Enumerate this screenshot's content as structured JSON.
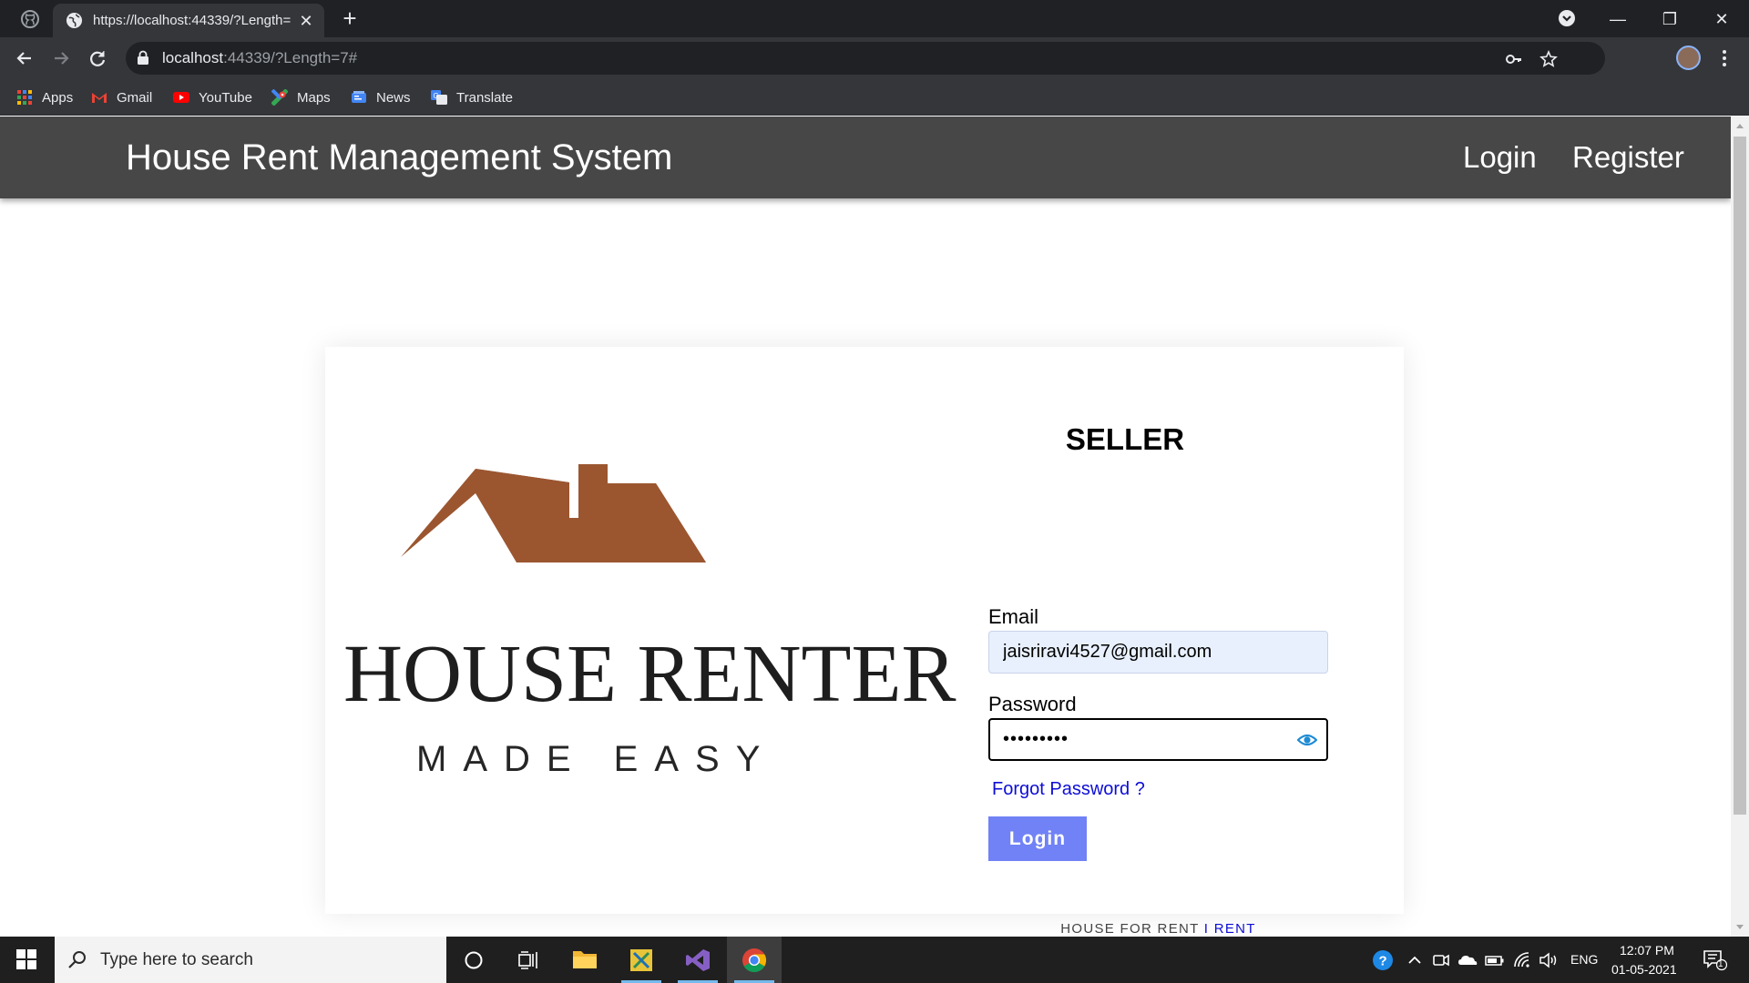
{
  "browser": {
    "tab_title": "https://localhost:44339/?Length=",
    "url_host": "localhost",
    "url_rest": ":44339/?Length=7#",
    "bookmarks": [
      {
        "label": "Apps",
        "icon": "apps-grid-icon"
      },
      {
        "label": "Gmail",
        "icon": "gmail-icon"
      },
      {
        "label": "YouTube",
        "icon": "youtube-icon"
      },
      {
        "label": "Maps",
        "icon": "maps-icon"
      },
      {
        "label": "News",
        "icon": "news-icon"
      },
      {
        "label": "Translate",
        "icon": "translate-icon"
      }
    ]
  },
  "site": {
    "brand": "House Rent Management System",
    "nav": {
      "login": "Login",
      "register": "Register"
    }
  },
  "logo": {
    "title": "HOUSE RENTER",
    "subtitle": "MADE EASY",
    "roof_color": "#9b5630"
  },
  "form": {
    "heading": "SELLER",
    "email_label": "Email",
    "email_value": "jaisriravi4527@gmail.com",
    "password_label": "Password",
    "password_mask": "•••••••••",
    "forgot_label": "Forgot Password ?",
    "login_button": "Login",
    "login_button_color": "#7082f5",
    "footer_left": "HOUSE FOR RENT",
    "footer_sep": "I",
    "footer_right": "RENT"
  },
  "taskbar": {
    "search_placeholder": "Type here to search",
    "language": "ENG",
    "time": "12:07 PM",
    "date": "01-05-2021",
    "notification_count": "1"
  }
}
